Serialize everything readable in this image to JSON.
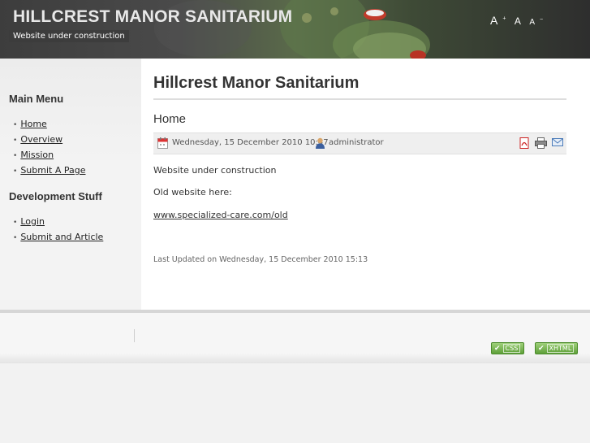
{
  "header": {
    "site_title": "HILLCREST MANOR SANITARIUM",
    "slogan": "Website under construction",
    "font_tools": {
      "increase": "A",
      "reset": "A",
      "decrease": "A",
      "plus": "+",
      "minus": "−"
    }
  },
  "sidebar": {
    "main_menu": {
      "title": "Main Menu",
      "items": [
        "Home",
        "Overview",
        "Mission",
        "Submit A Page"
      ]
    },
    "dev_menu": {
      "title": "Development Stuff",
      "items": [
        "Login",
        "Submit and Article"
      ]
    }
  },
  "main": {
    "page_heading": "Hillcrest Manor Sanitarium",
    "article_title": "Home",
    "meta": {
      "date": "Wednesday, 15 December 2010 10:47",
      "author": "administrator"
    },
    "body": {
      "p1": "Website under construction",
      "p2": "Old website here:",
      "link": "www.specialized-care.com/old"
    },
    "last_updated": "Last Updated on Wednesday, 15 December 2010 15:13"
  },
  "footer": {
    "badge_css": "CSS",
    "badge_xhtml": "XHTML"
  },
  "colors": {
    "header_bg": "#3d3d3d",
    "badge_green": "#6aab45",
    "pdf_red": "#cc2222",
    "mail_blue": "#4a7ab8"
  }
}
